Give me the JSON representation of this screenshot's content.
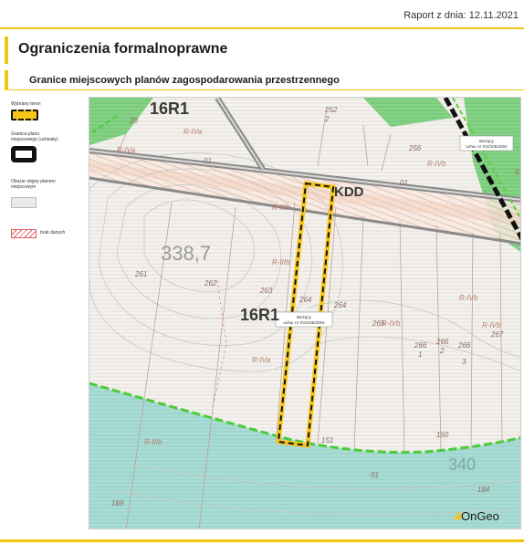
{
  "report": {
    "date_label": "Raport z dnia: 12.11.2021"
  },
  "section": {
    "title": "Ograniczenia formalnoprawne"
  },
  "subsection": {
    "title": "Granice miejscowych planów zagospodarowania przestrzennego"
  },
  "legend": {
    "selected_area": "Wybrany teren",
    "plan_boundary": "Granica planu miejscowego (uchwały)",
    "plan_area": "Obszar objęty planem miejscowym",
    "no_data": "brak danych"
  },
  "map": {
    "zones": [
      "16R1",
      "16R1",
      "KDD"
    ],
    "elevations": [
      "338,7",
      "340"
    ],
    "soil_classes": [
      "R-IVa",
      "R-IVb",
      "R-IIIb",
      "R-IIIb",
      "R-IVb",
      "R-IVb",
      "R-IVb",
      "R-IVa",
      "R-IIIb",
      "R-IVa"
    ],
    "parcels": [
      "20",
      "252",
      "2",
      "256",
      "261",
      "262",
      "263",
      "264",
      "264",
      "265",
      "266",
      "266",
      "266",
      "267",
      "1",
      "2",
      "3",
      "169",
      "151",
      "150",
      "184",
      "01",
      "01",
      "01",
      "01"
    ],
    "callout_top": {
      "title": "Bieżący",
      "text": "uchw. nr XVI/105/2004"
    },
    "callout_center": {
      "title": "Bieżący",
      "text": "uchw. nr XVI/106/2004"
    }
  },
  "brand": {
    "name": "OnGeo"
  },
  "colors": {
    "accent": "#f2c40f",
    "selection": "#f5c518",
    "forest": "#7ed07a",
    "water": "#9fd6cf",
    "boundary": "#111111"
  }
}
